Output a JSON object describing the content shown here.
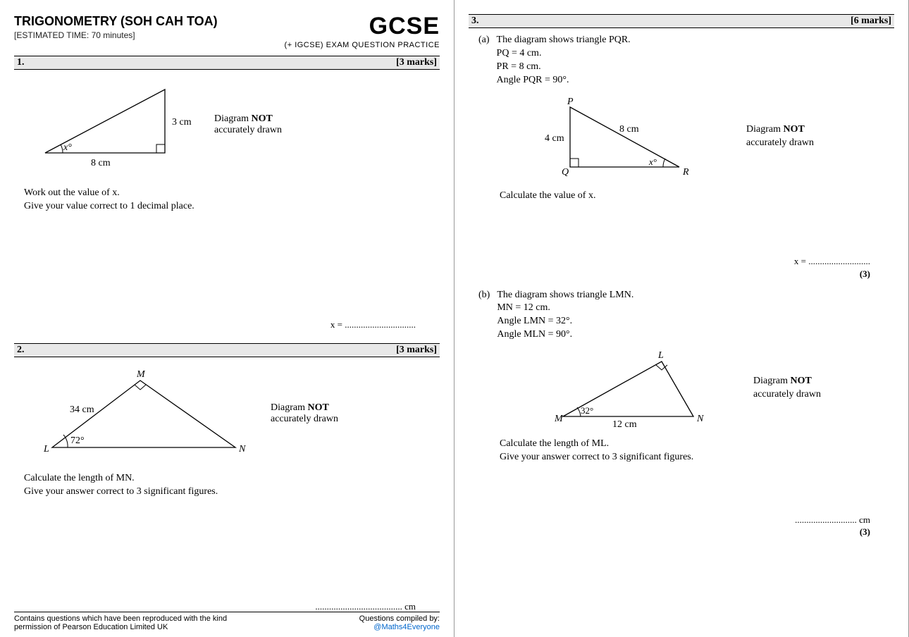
{
  "header": {
    "title": "TRIGONOMETRY (SOH CAH TOA)",
    "time": "[ESTIMATED TIME: 70 minutes]",
    "logo": "GCSE",
    "logo_sub": "(+ IGCSE) EXAM QUESTION PRACTICE"
  },
  "q1": {
    "num": "1.",
    "marks": "[3 marks]",
    "side_bottom": "8 cm",
    "side_right": "3 cm",
    "angle": "x°",
    "notdrawn1": "Diagram ",
    "notdrawn2": "NOT",
    "notdrawn3": "accurately drawn",
    "line1": "Work out the value of x.",
    "line2": "Give your value correct to 1 decimal place.",
    "ans": "x = ..............................."
  },
  "q2": {
    "num": "2.",
    "marks": "[3 marks]",
    "Mlabel": "M",
    "Llabel": "L",
    "Nlabel": "N",
    "side": "34 cm",
    "angle": "72°",
    "notdrawn1": "Diagram ",
    "notdrawn2": "NOT",
    "notdrawn3": "accurately drawn",
    "line1": "Calculate the length of MN.",
    "line2": "Give your answer correct to 3 significant figures.",
    "ans": "...................................... cm"
  },
  "q3": {
    "num": "3.",
    "marks": "[6 marks]",
    "a": {
      "label": "(a)",
      "l1": "The diagram shows triangle PQR.",
      "l2": "PQ = 4 cm.",
      "l3": "PR = 8 cm.",
      "l4": "Angle PQR = 90°.",
      "Plabel": "P",
      "Qlabel": "Q",
      "Rlabel": "R",
      "s1": "4 cm",
      "s2": "8 cm",
      "angle": "x°",
      "notdrawn1": "Diagram ",
      "notdrawn2": "NOT",
      "notdrawn3": "accurately drawn",
      "calc": "Calculate the value of x.",
      "ans": "x = ...........................",
      "sub": "(3)"
    },
    "b": {
      "label": "(b)",
      "l1": "The diagram shows triangle LMN.",
      "l2": "MN = 12 cm.",
      "l3": "Angle LMN = 32°.",
      "l4": "Angle MLN = 90°.",
      "Llabel": "L",
      "Mlabel": "M",
      "Nlabel": "N",
      "s1": "12 cm",
      "angle": "32°",
      "notdrawn1": "Diagram ",
      "notdrawn2": "NOT",
      "notdrawn3": "accurately drawn",
      "calc1": "Calculate the length of ML.",
      "calc2": "Give your answer correct to 3 significant figures.",
      "ans": "........................... cm",
      "sub": "(3)"
    }
  },
  "footer": {
    "l1": "Contains questions which have been reproduced with the kind",
    "l2": "permission of Pearson Education Limited UK",
    "r1": "Questions compiled by:",
    "r2": "@Maths4Everyone"
  }
}
